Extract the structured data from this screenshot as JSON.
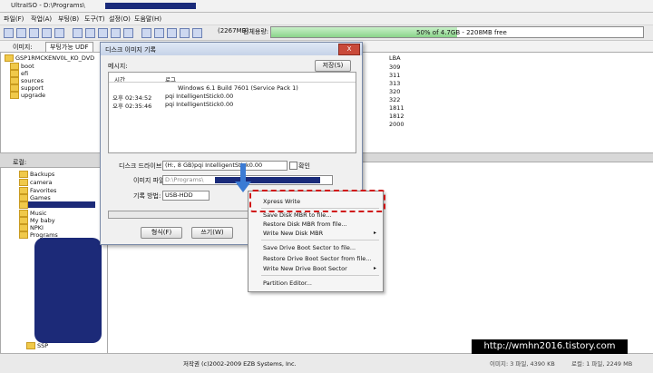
{
  "window": {
    "title": "UltraISO - D:\\Programs\\"
  },
  "menu": [
    "파일(F)",
    "작업(A)",
    "부팅(B)",
    "도구(T)",
    "설정(O)",
    "도움말(H)"
  ],
  "toolbar": {
    "space_label": "전체용량:",
    "space_value": "(2267MB)",
    "space_bar_text": "50% of 4.7GB - 2208MB free",
    "space_fraction": 0.5
  },
  "image_row": {
    "label": "이미지:",
    "value": "부팅가능 UDF"
  },
  "iso_tree": {
    "root": "GSP1RMCKENV0L_KO_DVD",
    "items": [
      "boot",
      "efi",
      "sources",
      "support",
      "upgrade"
    ]
  },
  "lba": {
    "header": "LBA",
    "values": [
      "309",
      "311",
      "313",
      "320",
      "322",
      "1811",
      "1812",
      "2000"
    ]
  },
  "local": {
    "label": "로컬:",
    "items": [
      "Backups",
      "camera",
      "Favorites",
      "Games",
      "",
      "Music",
      "My baby",
      "NPKI",
      "Programs"
    ],
    "bottom_item": "SSP"
  },
  "dialog": {
    "title": "디스크 이미지 기록",
    "close": "X",
    "message_label": "메시지:",
    "save_button": "저장(S)",
    "col_time": "시간",
    "col_log": "로그",
    "log_header": "Windows 6.1 Build 7601 (Service Pack 1)",
    "logs": [
      {
        "time": "오후 02:34:52",
        "text": "pqi     IntelligentStick0.00"
      },
      {
        "time": "오후 02:35:46",
        "text": "pqi     IntelligentStick0.00"
      }
    ],
    "drive_label": "디스크 드라이브:",
    "drive_value": "(H:, 8 GB)pqi    IntelligentStick0.00",
    "verify_label": "확인",
    "image_file_label": "이미지 파일:",
    "image_file_value": "D:\\Programs\\",
    "write_method_label": "기록 방법:",
    "write_method_value": "USB-HDD",
    "format_button": "형식(F)",
    "write_button": "쓰기(W)"
  },
  "context_menu": {
    "items": [
      {
        "label": "Xpress Write"
      },
      {
        "label": "Save Disk MBR to file..."
      },
      {
        "label": "Restore Disk MBR from file..."
      },
      {
        "label": "Write New Disk MBR",
        "submenu": true
      },
      {
        "label": "Save Drive Boot Sector to file..."
      },
      {
        "label": "Restore Drive Boot Sector from file..."
      },
      {
        "label": "Write New Drive Boot Sector",
        "submenu": true
      },
      {
        "label": "Partition Editor..."
      }
    ]
  },
  "status": {
    "copyright": "저작권 (c)2002-2009 EZB Systems, Inc.",
    "image_info": "이미지: 3 파일, 4390 KB",
    "local_info": "로컬: 1 파일, 2249 MB"
  },
  "watermark": "http://wmhn2016.tistory.com",
  "colors": {
    "accent": "#3b7bd4",
    "highlight": "#d01414",
    "redaction": "#1a2b7a"
  }
}
